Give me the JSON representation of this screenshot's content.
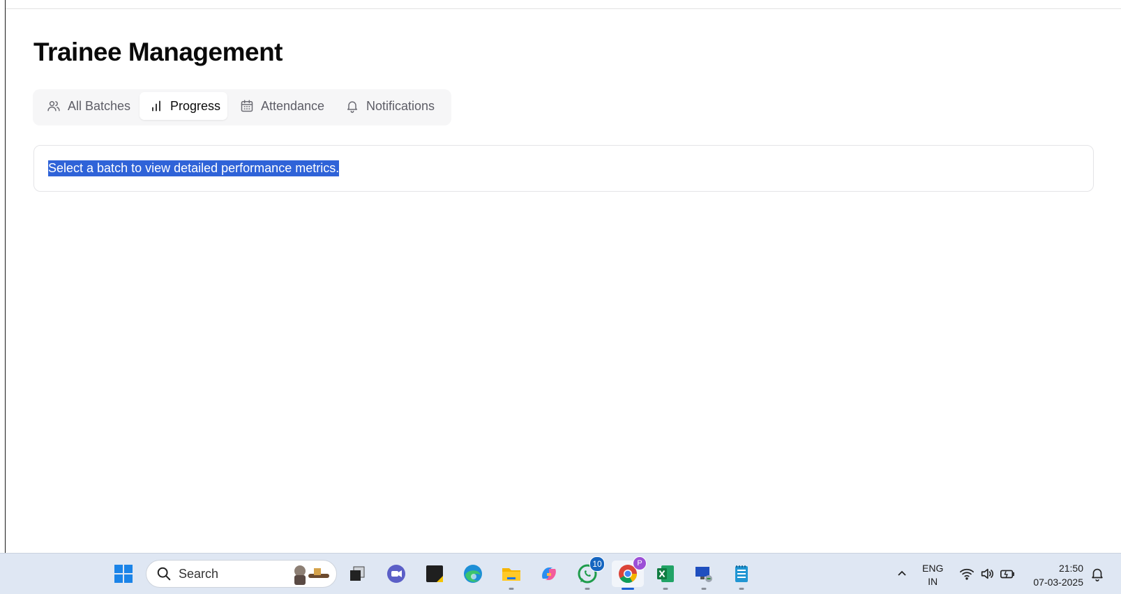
{
  "page": {
    "title": "Trainee Management"
  },
  "tabs": [
    {
      "label": "All Batches",
      "icon": "users-icon",
      "active": false
    },
    {
      "label": "Progress",
      "icon": "bar-chart-icon",
      "active": true
    },
    {
      "label": "Attendance",
      "icon": "calendar-icon",
      "active": false
    },
    {
      "label": "Notifications",
      "icon": "bell-icon",
      "active": false
    }
  ],
  "main": {
    "message": "Select a batch to view detailed performance metrics."
  },
  "taskbar": {
    "search_label": "Search",
    "apps": [
      {
        "name": "windows-start",
        "icon": "windows-logo-icon"
      },
      {
        "name": "task-view",
        "icon": "task-view-icon"
      },
      {
        "name": "meet",
        "icon": "video-chat-icon"
      },
      {
        "name": "sticky-notes",
        "icon": "sticky-notes-icon"
      },
      {
        "name": "edge",
        "icon": "edge-icon"
      },
      {
        "name": "file-explorer",
        "icon": "folder-icon"
      },
      {
        "name": "copilot",
        "icon": "copilot-icon"
      },
      {
        "name": "whatsapp",
        "icon": "whatsapp-icon",
        "badge": "10"
      },
      {
        "name": "chrome",
        "icon": "chrome-icon",
        "badge": "P"
      },
      {
        "name": "excel",
        "icon": "excel-icon"
      },
      {
        "name": "remote-desktop",
        "icon": "remote-desktop-icon"
      },
      {
        "name": "notepad",
        "icon": "notepad-icon"
      }
    ],
    "tray": {
      "lang_line1": "ENG",
      "lang_line2": "IN",
      "time": "21:50",
      "date": "07-03-2025"
    }
  },
  "colors": {
    "selection": "#2f63d8",
    "tab_bg": "#f6f6f7",
    "taskbar_bg": "#dfe7f3"
  }
}
